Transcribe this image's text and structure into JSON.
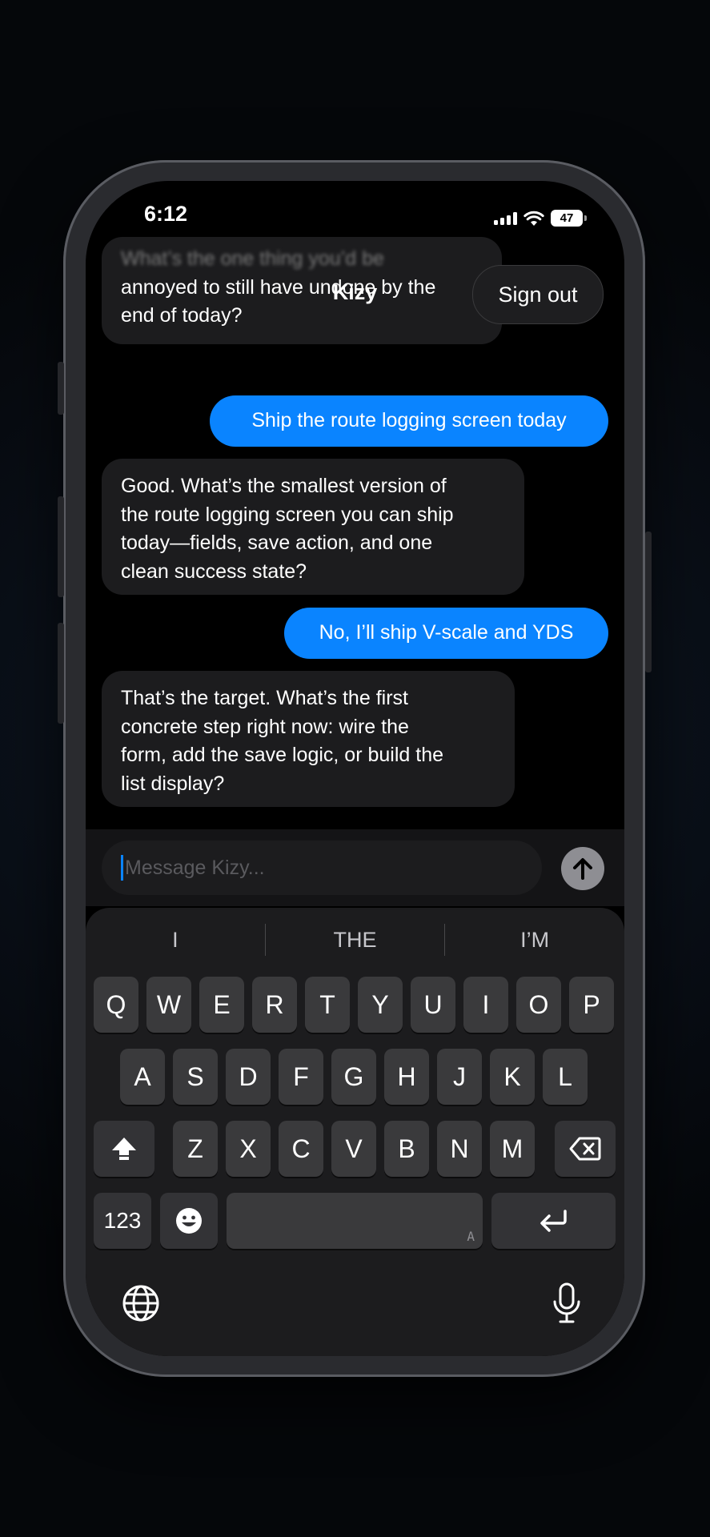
{
  "status": {
    "time": "6:12",
    "battery": "47"
  },
  "header": {
    "title": "Kizy",
    "signout_label": "Sign out"
  },
  "messages": [
    {
      "role": "bot",
      "lines": [
        "What’s the one thing you’d be",
        "annoyed to still have undone by the",
        "end of today?"
      ]
    },
    {
      "role": "user",
      "text": "Ship the route logging screen today"
    },
    {
      "role": "bot",
      "lines": [
        "Good. What’s the smallest version of",
        "the route logging screen you can ship",
        "today—fields, save action, and one",
        "clean success state?"
      ]
    },
    {
      "role": "user",
      "text": "No, I’ll ship V-scale and YDS"
    },
    {
      "role": "bot",
      "lines": [
        "That’s the target. What’s the first",
        "concrete step right now: wire the",
        "form, add the save logic, or build the",
        "list display?"
      ]
    }
  ],
  "composer": {
    "placeholder": "Message Kizy..."
  },
  "keyboard": {
    "suggestions": [
      "I",
      "THE",
      "I’M"
    ],
    "row1": [
      "Q",
      "W",
      "E",
      "R",
      "T",
      "Y",
      "U",
      "I",
      "O",
      "P"
    ],
    "row2": [
      "A",
      "S",
      "D",
      "F",
      "G",
      "H",
      "J",
      "K",
      "L"
    ],
    "row3": [
      "Z",
      "X",
      "C",
      "V",
      "B",
      "N",
      "M"
    ],
    "numbers_label": "123",
    "space_hint": "A"
  },
  "icons": {
    "wifi": "wifi-icon",
    "signal": "cellular-signal-icon",
    "send": "arrow-up-icon",
    "shift": "shift-icon",
    "delete": "backspace-icon",
    "emoji": "emoji-icon",
    "return": "return-icon",
    "globe": "globe-icon",
    "mic": "microphone-icon"
  },
  "colors": {
    "accent": "#0a84ff",
    "bubble_bot": "#1c1c1e",
    "background": "#000000"
  }
}
